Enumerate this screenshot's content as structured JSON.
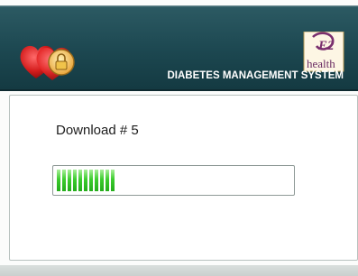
{
  "header": {
    "brand_text": "health",
    "brand_mark": "E2",
    "subtitle": "DIABETES MANAGEMENT SYSTEM"
  },
  "dialog": {
    "status_text": "Download # 5",
    "progress_fraction": 0.27,
    "progress_color": "#3ccc2e"
  },
  "icons": {
    "logo": "hearts-padlock-logo-icon",
    "brand": "e2-health-logo-icon"
  }
}
